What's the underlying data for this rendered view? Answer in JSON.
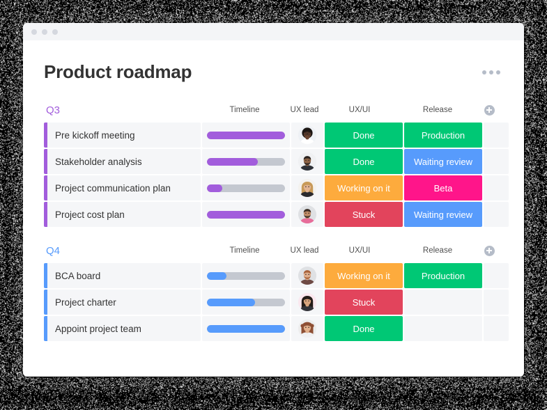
{
  "window": {
    "traffic_lights": [
      "dot-1",
      "dot-2",
      "dot-3"
    ]
  },
  "header": {
    "title": "Product roadmap",
    "more_menu_icon": "more-horizontal-icon"
  },
  "colors": {
    "q3_accent": "#a25ddc",
    "q4_accent": "#579bfc",
    "done_green": "#00c875",
    "production_green": "#00c875",
    "working_orange": "#fdab3d",
    "stuck_red": "#e2445c",
    "waiting_blue": "#579bfc",
    "beta_pink": "#ff158a",
    "row_bg": "#f5f6f8",
    "track_gray": "#c4c8d0"
  },
  "columns": {
    "timeline": "Timeline",
    "ux_lead": "UX lead",
    "ux_ui": "UX/UI",
    "release": "Release",
    "add_column_icon": "plus-circle-icon"
  },
  "groups": [
    {
      "title": "Q3",
      "accent": "purple",
      "rows": [
        {
          "name": "Pre kickoff meeting",
          "progress": 100,
          "avatar": "avatar-woman-dark-glasses",
          "ux_ui": {
            "label": "Done",
            "color": "#00c875"
          },
          "release": {
            "label": "Production",
            "color": "#00c875"
          }
        },
        {
          "name": "Stakeholder analysis",
          "progress": 65,
          "avatar": "avatar-man-beard-dark",
          "ux_ui": {
            "label": "Done",
            "color": "#00c875"
          },
          "release": {
            "label": "Waiting review",
            "color": "#579bfc"
          }
        },
        {
          "name": "Project communication plan",
          "progress": 20,
          "avatar": "avatar-woman-blonde",
          "ux_ui": {
            "label": "Working on it",
            "color": "#fdab3d"
          },
          "release": {
            "label": "Beta",
            "color": "#ff158a"
          }
        },
        {
          "name": "Project cost plan",
          "progress": 100,
          "avatar": "avatar-man-beard-pink",
          "ux_ui": {
            "label": "Stuck",
            "color": "#e2445c"
          },
          "release": {
            "label": "Waiting review",
            "color": "#579bfc"
          }
        }
      ]
    },
    {
      "title": "Q4",
      "accent": "blue",
      "rows": [
        {
          "name": "BCA board",
          "progress": 25,
          "avatar": "avatar-man-ginger-beard",
          "ux_ui": {
            "label": "Working on it",
            "color": "#fdab3d"
          },
          "release": {
            "label": "Production",
            "color": "#00c875"
          }
        },
        {
          "name": "Project charter",
          "progress": 62,
          "avatar": "avatar-woman-dark-hair",
          "ux_ui": {
            "label": "Stuck",
            "color": "#e2445c"
          },
          "release": {
            "label": "",
            "color": ""
          }
        },
        {
          "name": "Appoint project team",
          "progress": 100,
          "avatar": "avatar-woman-curly-auburn",
          "ux_ui": {
            "label": "Done",
            "color": "#00c875"
          },
          "release": {
            "label": "",
            "color": ""
          }
        }
      ]
    }
  ]
}
